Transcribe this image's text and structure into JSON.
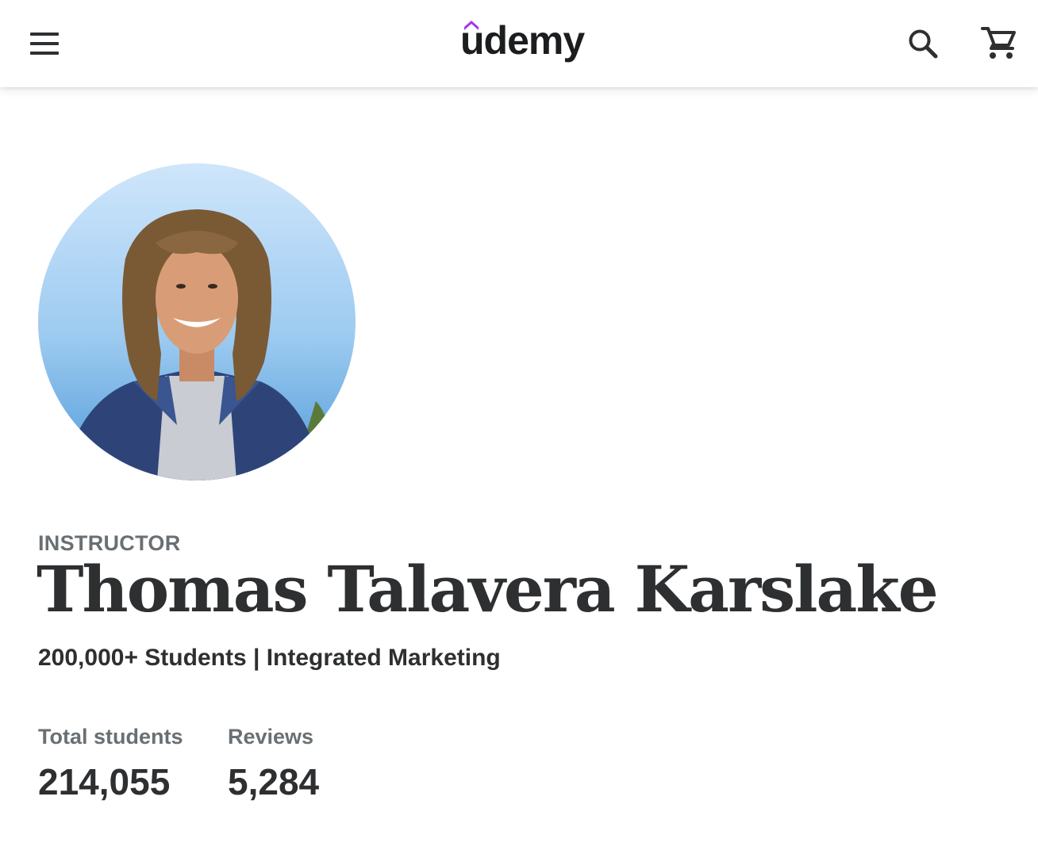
{
  "header": {
    "menu_icon": "hamburger-menu-icon",
    "logo_text": "udemy",
    "search_icon": "search-icon",
    "cart_icon": "shopping-cart-icon",
    "brand_color": "#a435f0"
  },
  "profile": {
    "eyebrow": "INSTRUCTOR",
    "name": "Thomas Talavera Karslake",
    "headline": "200,000+ Students | Integrated Marketing",
    "stats": [
      {
        "label": "Total students",
        "value": "214,055"
      },
      {
        "label": "Reviews",
        "value": "5,284"
      }
    ]
  }
}
